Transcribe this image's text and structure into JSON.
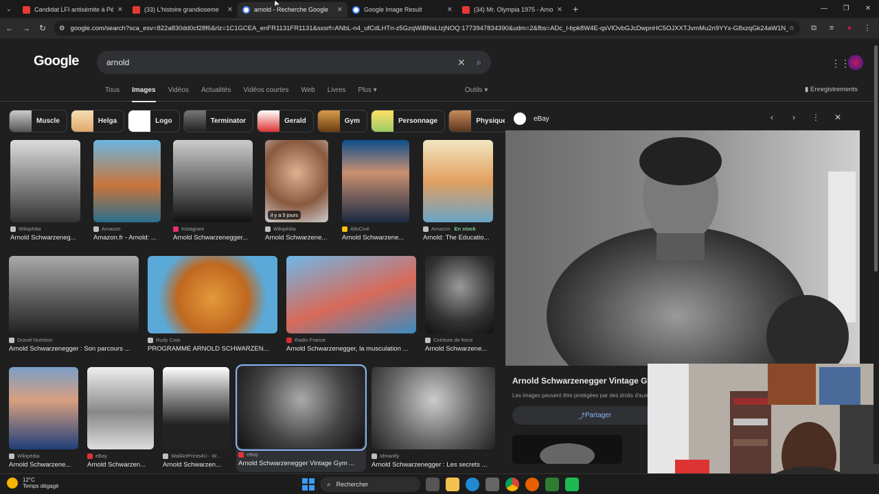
{
  "browser": {
    "tabs": [
      {
        "title": "Candidat LFI antisémite à Périg",
        "icon": "youtube-icon",
        "active": false
      },
      {
        "title": "(33) L'histoire grandioseme",
        "icon": "youtube-icon",
        "active": false
      },
      {
        "title": "arnold - Recherche Google",
        "icon": "google-icon",
        "active": true
      },
      {
        "title": "Google Image Result",
        "icon": "google-icon",
        "active": false
      },
      {
        "title": "(34) Mr. Olympia 1975 - Arnold",
        "icon": "youtube-icon",
        "active": false
      }
    ],
    "new_tab": "+",
    "url": "google.com/search?sca_esv=822a830dd0cf28f6&rlz=1C1GCEA_enFR1131FR1131&sxsrf=ANbL-n4_ufCdLHTn-z5GzqWiBNsLIzjNOQ:1773947834390&udm=2&fbs=ADc_l-bpk8W4E-qsVlOvbGJcDwpnHC5OJXXTJvmMu2n9YYx-G8xzqGk24aW1N_FyIND..."
  },
  "google": {
    "logo": "Google",
    "query": "arnold",
    "tabs": [
      "Tous",
      "Images",
      "Vidéos",
      "Actualités",
      "Vidéos courtes",
      "Web",
      "Livres",
      "Plus ▾"
    ],
    "active_tab": "Images",
    "tools": "Outils ▾",
    "saved": "Enregistrements"
  },
  "chips": [
    "Muscle",
    "Helga",
    "Logo",
    "Terminator",
    "Gerald",
    "Gym",
    "Personnage",
    "Physique"
  ],
  "results": [
    {
      "source": "Wikipédia",
      "title": "Arnold Schwarzeneg..."
    },
    {
      "source": "Amazon",
      "title": "Amazon.fr - Arnold: ..."
    },
    {
      "source": "Instagram",
      "title": "Arnold Schwarzenegger..."
    },
    {
      "source": "Wikipédia",
      "title": "Arnold Schwarzene...",
      "badge": "il y a 5 jours"
    },
    {
      "source": "AlloCiné",
      "title": "Arnold Schwarzene..."
    },
    {
      "source": "Amazon",
      "stock": "En stock",
      "title": "Arnold: The Educatio..."
    },
    {
      "source": "Dravel Nutrition",
      "title": "Arnold Schwarzenegger : Son parcours ..."
    },
    {
      "source": "Rudy Coia",
      "title": "PROGRAMME ARNOLD SCHWARZEN..."
    },
    {
      "source": "Radio France",
      "title": "Arnold Schwarzenegger, la musculation ..."
    },
    {
      "source": "Ceinture de force",
      "title": "Arnold Schwarzene..."
    },
    {
      "source": "Wikipédia",
      "title": "Arnold Schwarzene..."
    },
    {
      "source": "eBay",
      "title": "Arnold Schwarzen..."
    },
    {
      "source": "WallArtPrints4U - W...",
      "title": "Arnold Schwarzen..."
    },
    {
      "source": "eBay",
      "title": "Arnold Schwarzenegger Vintage Gym ..."
    },
    {
      "source": "Idmanify",
      "title": "Arnold Schwarzenegger : Les secrets ..."
    }
  ],
  "panel": {
    "source": "eBay",
    "title": "Arnold Schwarzenegger Vintage Gym",
    "note": "Les images peuvent être protégées par des droits d'auteur.",
    "share": "Partager"
  },
  "taskbar": {
    "temp": "12°C",
    "weather": "Temps dégagé",
    "search": "Rechercher"
  }
}
